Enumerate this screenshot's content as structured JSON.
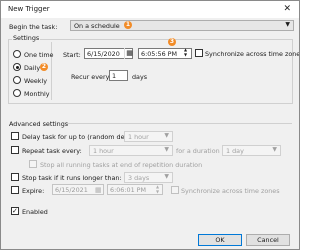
{
  "window": {
    "title": "New Trigger",
    "close_glyph": "✕"
  },
  "begin": {
    "label": "Begin the task:",
    "value": "On a schedule",
    "badge": "1"
  },
  "settings": {
    "title": "Settings",
    "options": [
      "One time",
      "Daily",
      "Weekly",
      "Monthly"
    ],
    "selected": "Daily",
    "daily_badge": "2",
    "start_label": "Start:",
    "start_date": "6/15/2020",
    "start_time": "6:05:56 PM",
    "time_badge": "3",
    "sync_label": "Synchronize across time zones",
    "recur_label": "Recur every:",
    "recur_value": "1",
    "recur_unit": "days"
  },
  "advanced": {
    "title": "Advanced settings",
    "delay_label": "Delay task for up to (random delay):",
    "delay_value": "1 hour",
    "repeat_label": "Repeat task every:",
    "repeat_value": "1 hour",
    "duration_label": "for a duration of:",
    "duration_value": "1 day",
    "stop_running_label": "Stop all running tasks at end of repetition duration",
    "stop_longer_label": "Stop task if it runs longer than:",
    "stop_longer_value": "3 days",
    "expire_label": "Expire:",
    "expire_date": "6/15/2021",
    "expire_time": "6:06:01 PM",
    "expire_sync_label": "Synchronize across time zones",
    "enabled_label": "Enabled"
  },
  "buttons": {
    "ok": "OK",
    "cancel": "Cancel"
  },
  "colors": {
    "badge": "#f28c28",
    "accent": "#0078d7"
  }
}
